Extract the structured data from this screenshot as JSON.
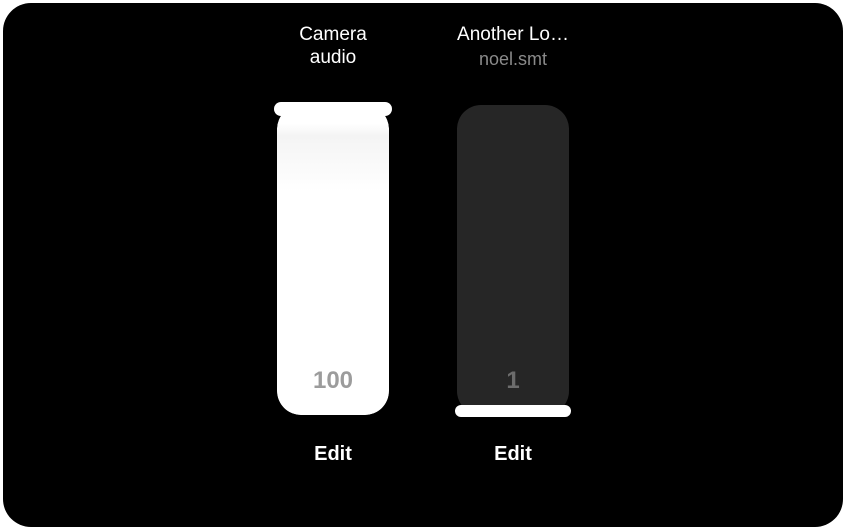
{
  "tracks": [
    {
      "title": "Camera\naudio",
      "subtitle": "",
      "value": "100",
      "level": 100,
      "edit_label": "Edit"
    },
    {
      "title": "Another Lo…",
      "subtitle": "noel.smt",
      "value": "1",
      "level": 1,
      "edit_label": "Edit"
    }
  ]
}
